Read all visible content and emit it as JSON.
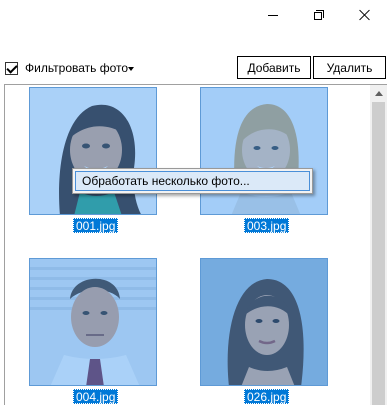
{
  "window": {
    "controls": [
      "minimize-icon",
      "maximize-icon",
      "close-icon"
    ]
  },
  "toolbar": {
    "filter_label": "Фильтровать фото",
    "filter_checked": true,
    "add_label": "Добавить",
    "delete_label": "Удалить"
  },
  "gallery": {
    "items": [
      {
        "caption": "001.jpg",
        "selected": true
      },
      {
        "caption": "003.jpg",
        "selected": true
      },
      {
        "caption": "004.jpg",
        "selected": true
      },
      {
        "caption": "026.jpg",
        "selected": true
      }
    ]
  },
  "context_menu": {
    "items": [
      {
        "label": "Обработать несколько фото..."
      }
    ]
  },
  "colors": {
    "selection": "#0078d7",
    "menu_highlight": "#dbe9f8",
    "menu_border": "#4a8fd8"
  }
}
